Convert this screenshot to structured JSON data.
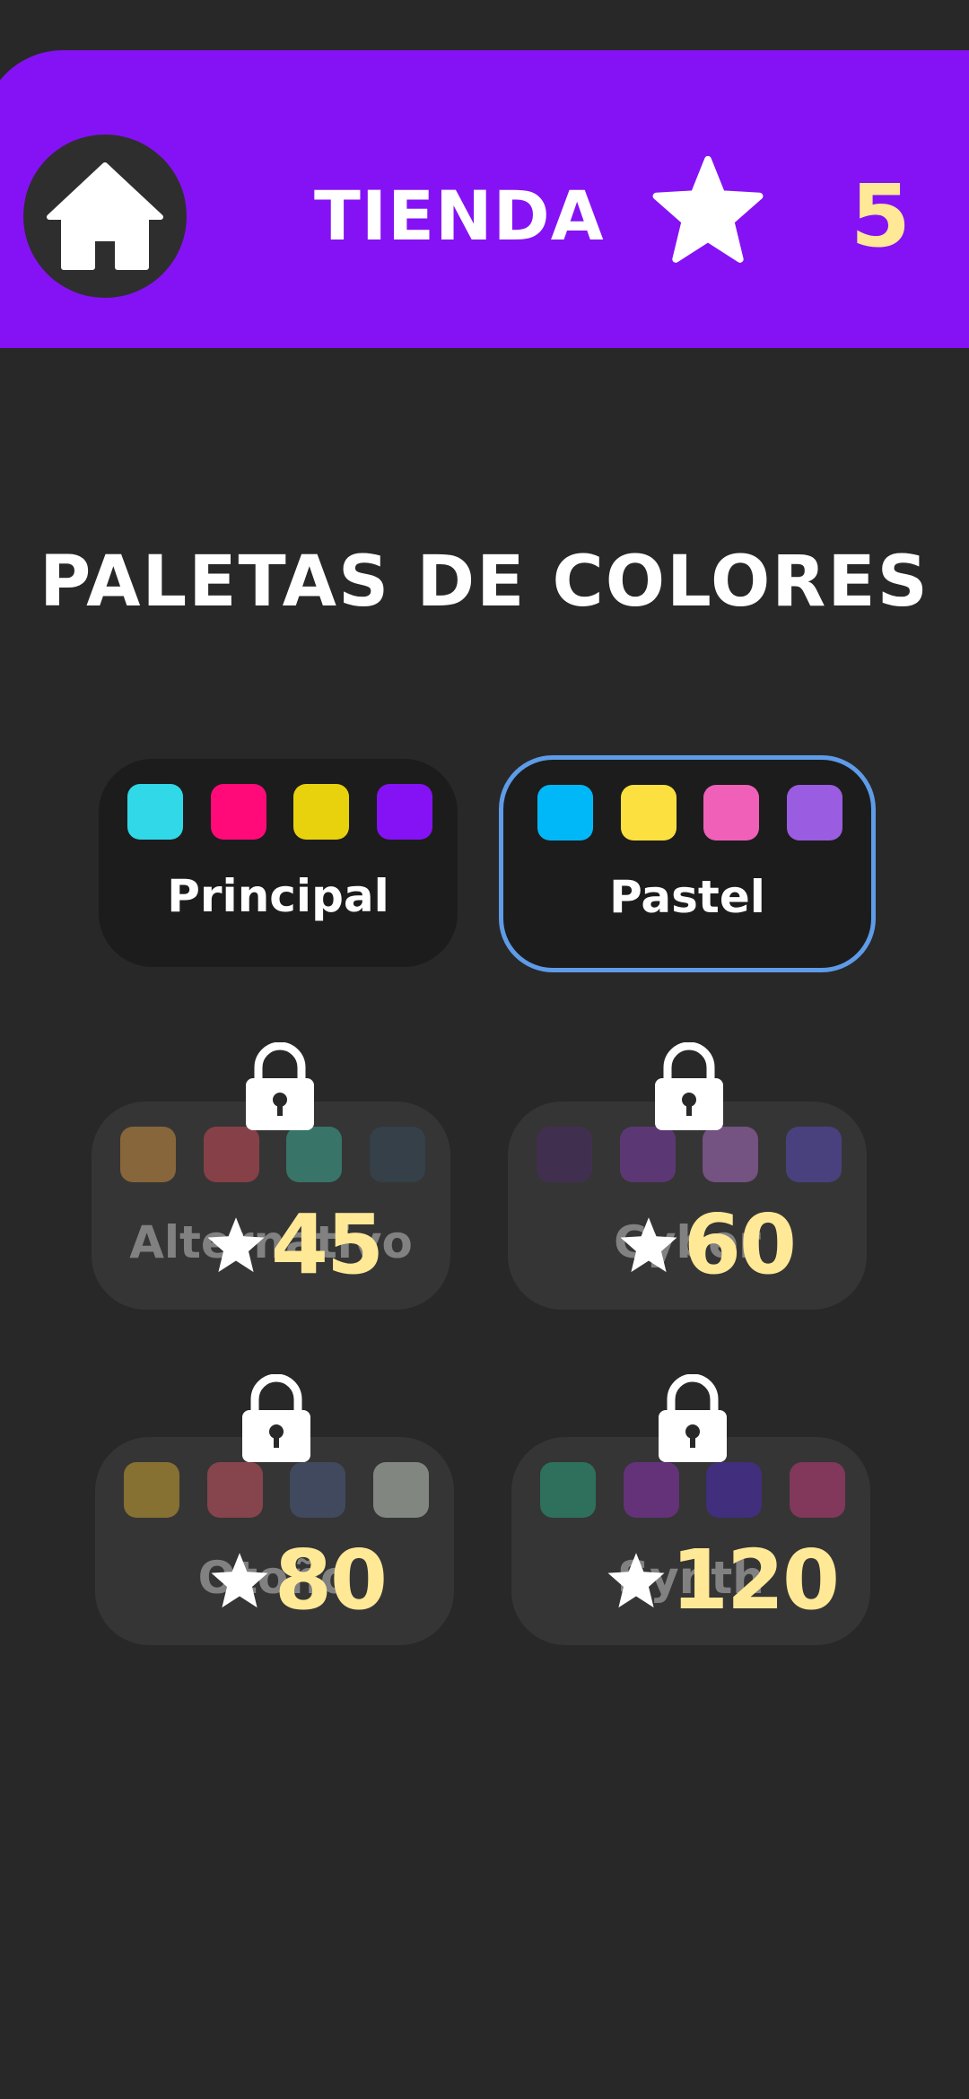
{
  "header": {
    "title": "TIENDA",
    "coins": "5",
    "home_icon": "home-icon",
    "star_icon": "star-icon"
  },
  "section": {
    "title": "PALETAS DE COLORES"
  },
  "palettes": [
    {
      "name": "Principal",
      "locked": false,
      "selected": false,
      "colors": [
        "#30D8E8",
        "#FF0A78",
        "#E8D20E",
        "#8512F4"
      ]
    },
    {
      "name": "Pastel",
      "locked": false,
      "selected": true,
      "colors": [
        "#00B8F8",
        "#FCE040",
        "#F060B8",
        "#9A5CE0"
      ]
    },
    {
      "name": "Alternativo",
      "locked": true,
      "price": "45",
      "colors": [
        "#C88E3E",
        "#C84858",
        "#3AA890",
        "#344858"
      ]
    },
    {
      "name": "Cyber",
      "locked": true,
      "price": "60",
      "colors": [
        "#4A2A64",
        "#7A3AA8",
        "#A86AC0",
        "#5A4AB8"
      ]
    },
    {
      "name": "Otoño",
      "locked": true,
      "price": "80",
      "colors": [
        "#C8A030",
        "#C85060",
        "#4A5A80",
        "#C0C8C0"
      ]
    },
    {
      "name": "Synth",
      "locked": true,
      "price": "120",
      "colors": [
        "#28A07A",
        "#8A30B0",
        "#4A28B8",
        "#C03A78"
      ]
    }
  ],
  "colors": {
    "accent": "#8512F4",
    "coin": "#FFE996",
    "selected_border": "#5E9BE8"
  }
}
